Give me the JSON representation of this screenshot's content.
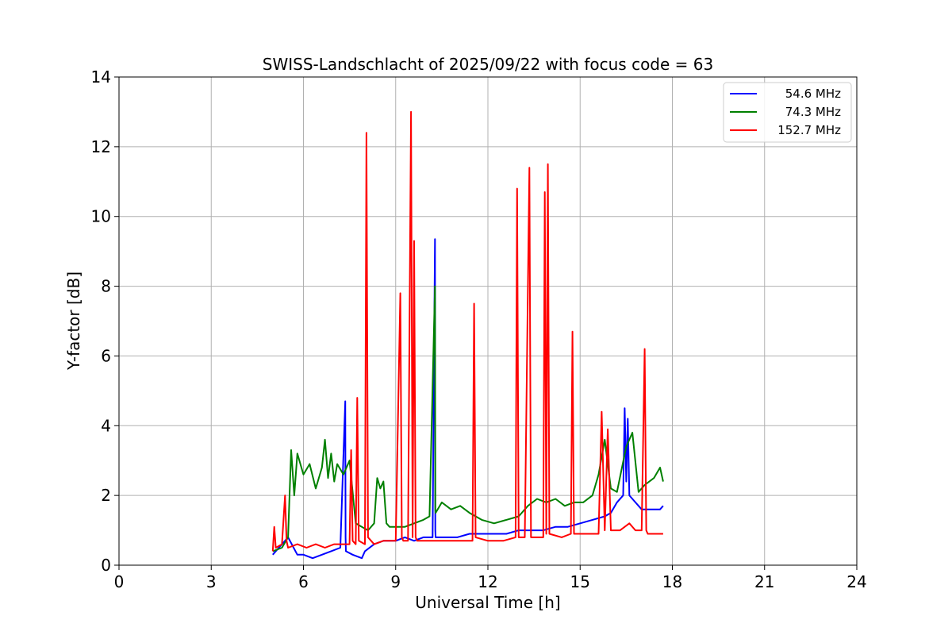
{
  "chart_data": {
    "type": "line",
    "title": "SWISS-Landschlacht of 2025/09/22 with focus code = 63",
    "xlabel": "Universal Time [h]",
    "ylabel": "Y-factor [dB]",
    "xlim": [
      0,
      24
    ],
    "ylim": [
      0,
      14
    ],
    "xticks": [
      0,
      3,
      6,
      9,
      12,
      15,
      18,
      21,
      24
    ],
    "yticks": [
      0,
      2,
      4,
      6,
      8,
      10,
      12,
      14
    ],
    "grid": true,
    "legend_position": "top-right",
    "series": [
      {
        "name": "  54.6 MHz",
        "color": "#0000ff",
        "x": [
          5.0,
          5.2,
          5.5,
          5.8,
          6.0,
          6.3,
          6.6,
          6.9,
          7.2,
          7.36,
          7.37,
          7.38,
          7.6,
          7.9,
          8.0,
          8.3,
          8.6,
          9.0,
          9.3,
          9.6,
          9.9,
          10.2,
          10.28,
          10.29,
          10.3,
          10.6,
          11.0,
          11.4,
          11.8,
          12.2,
          12.6,
          13.0,
          13.4,
          13.8,
          14.2,
          14.6,
          15.0,
          15.4,
          15.8,
          16.0,
          16.2,
          16.4,
          16.45,
          16.5,
          16.55,
          16.6,
          16.8,
          17.0,
          17.3,
          17.6,
          17.7
        ],
        "y": [
          0.3,
          0.5,
          0.8,
          0.3,
          0.3,
          0.2,
          0.3,
          0.4,
          0.5,
          4.7,
          0.8,
          0.4,
          0.3,
          0.2,
          0.4,
          0.6,
          0.7,
          0.7,
          0.8,
          0.7,
          0.8,
          0.8,
          9.35,
          1.0,
          0.8,
          0.8,
          0.8,
          0.9,
          0.9,
          0.9,
          0.9,
          1.0,
          1.0,
          1.0,
          1.1,
          1.1,
          1.2,
          1.3,
          1.4,
          1.5,
          1.8,
          2.0,
          4.5,
          2.4,
          4.2,
          2.0,
          1.8,
          1.6,
          1.6,
          1.6,
          1.7
        ]
      },
      {
        "name": "  74.3 MHz",
        "color": "#008000",
        "x": [
          5.0,
          5.3,
          5.5,
          5.6,
          5.7,
          5.8,
          6.0,
          6.2,
          6.4,
          6.6,
          6.7,
          6.8,
          6.9,
          7.0,
          7.1,
          7.3,
          7.5,
          7.7,
          7.9,
          8.1,
          8.3,
          8.4,
          8.5,
          8.6,
          8.7,
          8.8,
          9.0,
          9.3,
          9.6,
          9.9,
          10.1,
          10.28,
          10.29,
          10.3,
          10.5,
          10.8,
          11.1,
          11.4,
          11.8,
          12.2,
          12.6,
          13.0,
          13.3,
          13.6,
          13.9,
          14.2,
          14.5,
          14.8,
          15.1,
          15.4,
          15.6,
          15.8,
          15.9,
          16.0,
          16.2,
          16.5,
          16.7,
          16.9,
          17.1,
          17.4,
          17.6,
          17.7
        ],
        "y": [
          0.4,
          0.5,
          0.8,
          3.3,
          2.0,
          3.2,
          2.6,
          2.9,
          2.2,
          2.8,
          3.6,
          2.5,
          3.2,
          2.4,
          2.9,
          2.6,
          3.0,
          1.2,
          1.1,
          1.0,
          1.2,
          2.5,
          2.2,
          2.4,
          1.2,
          1.1,
          1.1,
          1.1,
          1.2,
          1.3,
          1.4,
          8.0,
          1.6,
          1.5,
          1.8,
          1.6,
          1.7,
          1.5,
          1.3,
          1.2,
          1.3,
          1.4,
          1.7,
          1.9,
          1.8,
          1.9,
          1.7,
          1.8,
          1.8,
          2.0,
          2.6,
          3.6,
          2.9,
          2.2,
          2.1,
          3.4,
          3.8,
          2.1,
          2.3,
          2.5,
          2.8,
          2.4
        ]
      },
      {
        "name": "152.7 MHz",
        "color": "#ff0000",
        "x": [
          5.0,
          5.05,
          5.1,
          5.3,
          5.4,
          5.45,
          5.5,
          5.8,
          6.1,
          6.4,
          6.7,
          7.0,
          7.3,
          7.5,
          7.55,
          7.6,
          7.7,
          7.75,
          7.8,
          8.0,
          8.05,
          8.1,
          8.3,
          8.6,
          9.0,
          9.15,
          9.2,
          9.25,
          9.4,
          9.5,
          9.55,
          9.6,
          9.65,
          9.7,
          10.0,
          10.4,
          10.8,
          11.2,
          11.5,
          11.55,
          11.6,
          12.0,
          12.5,
          12.9,
          12.95,
          13.0,
          13.2,
          13.35,
          13.4,
          13.45,
          13.6,
          13.8,
          13.85,
          13.9,
          13.95,
          14.0,
          14.4,
          14.7,
          14.75,
          14.8,
          15.2,
          15.6,
          15.7,
          15.8,
          15.9,
          16.0,
          16.3,
          16.6,
          16.8,
          17.0,
          17.1,
          17.15,
          17.2,
          17.5,
          17.7
        ],
        "y": [
          0.4,
          1.1,
          0.5,
          0.6,
          2.0,
          0.7,
          0.5,
          0.6,
          0.5,
          0.6,
          0.5,
          0.6,
          0.6,
          0.6,
          3.3,
          0.7,
          0.6,
          4.8,
          0.7,
          0.6,
          12.4,
          0.8,
          0.6,
          0.7,
          0.7,
          7.8,
          0.8,
          0.7,
          0.7,
          13.0,
          0.8,
          9.3,
          0.8,
          0.7,
          0.7,
          0.7,
          0.7,
          0.7,
          0.7,
          7.5,
          0.8,
          0.7,
          0.7,
          0.8,
          10.8,
          0.8,
          0.8,
          11.4,
          0.8,
          0.8,
          0.8,
          0.8,
          10.7,
          0.9,
          11.5,
          0.9,
          0.8,
          0.9,
          6.7,
          0.9,
          0.9,
          0.9,
          4.4,
          1.0,
          3.9,
          1.0,
          1.0,
          1.2,
          1.0,
          1.0,
          6.2,
          1.0,
          0.9,
          0.9,
          0.9
        ]
      }
    ]
  }
}
